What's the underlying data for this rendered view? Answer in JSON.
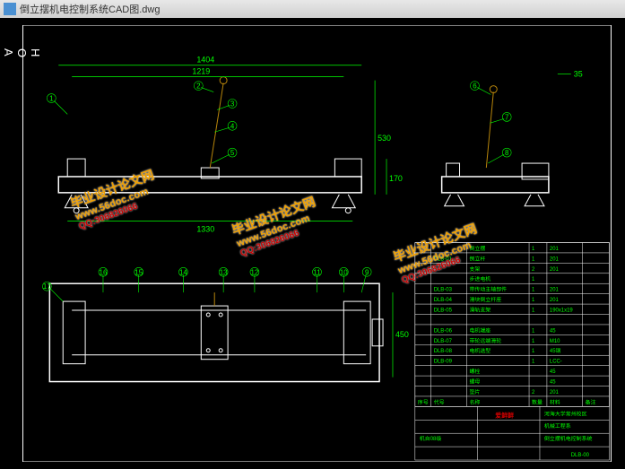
{
  "title": "倒立摆机电控制系统CAD图.dwg",
  "side_letters": [
    "A",
    "O",
    "H"
  ],
  "dimensions": {
    "front_top1": "1404",
    "front_top2": "1219",
    "front_bottom": "1330",
    "front_h1": "530",
    "front_h2": "170",
    "side_right": "35",
    "plan_h": "450"
  },
  "balloons_front": [
    "1",
    "2",
    "3",
    "4",
    "5"
  ],
  "balloons_side": [
    "6",
    "7",
    "8"
  ],
  "balloons_plan": [
    "9",
    "10",
    "11",
    "12",
    "13",
    "14",
    "15",
    "16",
    "17"
  ],
  "bom": [
    {
      "no": "",
      "code": "",
      "name": "垫片",
      "qty": "2",
      "mat": "201",
      "note": ""
    },
    {
      "no": "",
      "code": "",
      "name": "螺母",
      "qty": "",
      "mat": "45",
      "note": ""
    },
    {
      "no": "",
      "code": "",
      "name": "螺栓",
      "qty": "",
      "mat": "45",
      "note": ""
    },
    {
      "no": "",
      "code": "DLB-09",
      "name": "",
      "qty": "1",
      "mat": "LCC-",
      "note": ""
    },
    {
      "no": "",
      "code": "DLB-08",
      "name": "电机选型",
      "qty": "1",
      "mat": "45钢",
      "note": ""
    },
    {
      "no": "",
      "code": "DLB-07",
      "name": "带轮远端滑轮",
      "qty": "1",
      "mat": "M10",
      "note": ""
    },
    {
      "no": "",
      "code": "DLB-06",
      "name": "电机端座",
      "qty": "1",
      "mat": "45",
      "note": ""
    },
    {
      "no": "",
      "code": "",
      "name": "",
      "qty": "",
      "mat": "",
      "note": ""
    },
    {
      "no": "",
      "code": "DLB-05",
      "name": "滑轨支架",
      "qty": "1",
      "mat": "190x1x19",
      "note": ""
    },
    {
      "no": "",
      "code": "DLB-04",
      "name": "滑块倒立杆座",
      "qty": "1",
      "mat": "201",
      "note": ""
    },
    {
      "no": "",
      "code": "DLB-03",
      "name": "带传动主轴部件",
      "qty": "1",
      "mat": "201",
      "note": ""
    },
    {
      "no": "",
      "code": "",
      "name": "步进电机",
      "qty": "1",
      "mat": "",
      "note": ""
    },
    {
      "no": "",
      "code": "",
      "name": "支架",
      "qty": "2",
      "mat": "201",
      "note": ""
    },
    {
      "no": "",
      "code": "DLB-01",
      "name": "倒立杆",
      "qty": "1",
      "mat": "201",
      "note": ""
    },
    {
      "no": "",
      "code": "",
      "name": "倒立摆",
      "qty": "1",
      "mat": "201",
      "note": ""
    }
  ],
  "bom_headers": [
    "序号",
    "代号",
    "名称",
    "数量",
    "材料",
    "备注"
  ],
  "titleblock": {
    "project": "倒立摆机电控制系统",
    "school": "河海大学常州校区",
    "dept": "机械工程系",
    "class": "机自08级",
    "drawing_no": "DLB-00",
    "signature": "爱鲜鲜"
  },
  "watermarks": [
    {
      "text": "www.56doc.com",
      "sub": "毕业设计论文网",
      "qq": "QQ:306826066"
    }
  ]
}
